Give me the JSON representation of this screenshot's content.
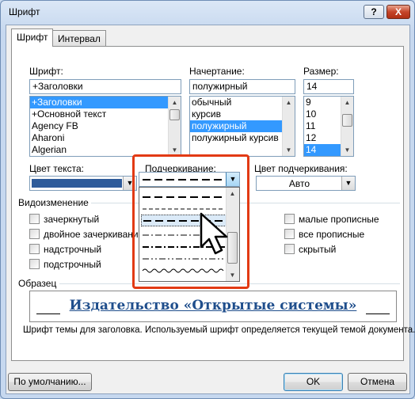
{
  "window": {
    "title": "Шрифт",
    "help_label": "?",
    "close_label": "X"
  },
  "tabs": [
    {
      "label": "Шрифт"
    },
    {
      "label": "Интервал"
    }
  ],
  "font": {
    "label": "Шрифт:",
    "value": "+Заголовки",
    "options": [
      "+Заголовки",
      "+Основной текст",
      "Agency FB",
      "Aharoni",
      "Algerian"
    ]
  },
  "style": {
    "label": "Начертание:",
    "value": "полужирный",
    "options": [
      "обычный",
      "курсив",
      "полужирный",
      "полужирный курсив"
    ]
  },
  "size": {
    "label": "Размер:",
    "value": "14",
    "options": [
      "9",
      "10",
      "11",
      "12",
      "14"
    ]
  },
  "font_color": {
    "label": "Цвет текста:",
    "swatch": "#2e5b9a"
  },
  "underline": {
    "label": "Подчеркивание:"
  },
  "underline_color": {
    "label": "Цвет подчеркивания:",
    "value": "Авто"
  },
  "effects": {
    "label": "Видоизменение",
    "left": [
      "зачеркнутый",
      "двойное зачеркивание",
      "надстрочный",
      "подстрочный"
    ],
    "right": [
      "малые прописные",
      "все прописные",
      "скрытый"
    ]
  },
  "preview": {
    "label": "Образец",
    "text": "Издательство «Открытые системы»",
    "note": "Шрифт темы для заголовка. Используемый шрифт определяется текущей темой документа."
  },
  "buttons": {
    "default": "По умолчанию...",
    "ok": "OK",
    "cancel": "Отмена"
  },
  "colors": {
    "accent": "#e23a14",
    "selection": "#3399ff",
    "preview_text": "#1f4e8c"
  }
}
